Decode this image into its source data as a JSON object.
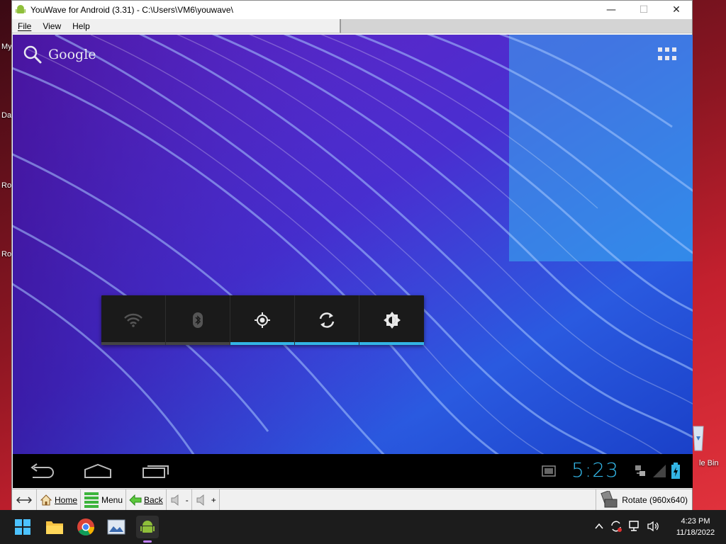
{
  "desktop": {
    "labels": [
      "My",
      "Da",
      "Ro",
      "Ro"
    ],
    "recycle_label": "le Bin"
  },
  "window": {
    "title": "YouWave for Android (3.31) - C:\\Users\\VM6\\youwave\\",
    "minimize": "—",
    "maximize": "☐",
    "close": "✕"
  },
  "menu": {
    "file": "File",
    "view": "View",
    "help": "Help"
  },
  "android": {
    "search_label": "Google",
    "quick_settings": [
      {
        "name": "wifi",
        "active": false
      },
      {
        "name": "bluetooth",
        "active": false
      },
      {
        "name": "gps",
        "active": true
      },
      {
        "name": "auto-rotate",
        "active": true
      },
      {
        "name": "brightness",
        "active": true
      }
    ],
    "clock": "5:23",
    "accent": "#33b5e5"
  },
  "toolbar": {
    "home": "Home",
    "menu": "Menu",
    "back": "Back",
    "vol_down": "-",
    "vol_up": "+",
    "rotate": "Rotate (960x640)"
  },
  "taskbar": {
    "time": "4:23 PM",
    "date": "11/18/2022"
  }
}
